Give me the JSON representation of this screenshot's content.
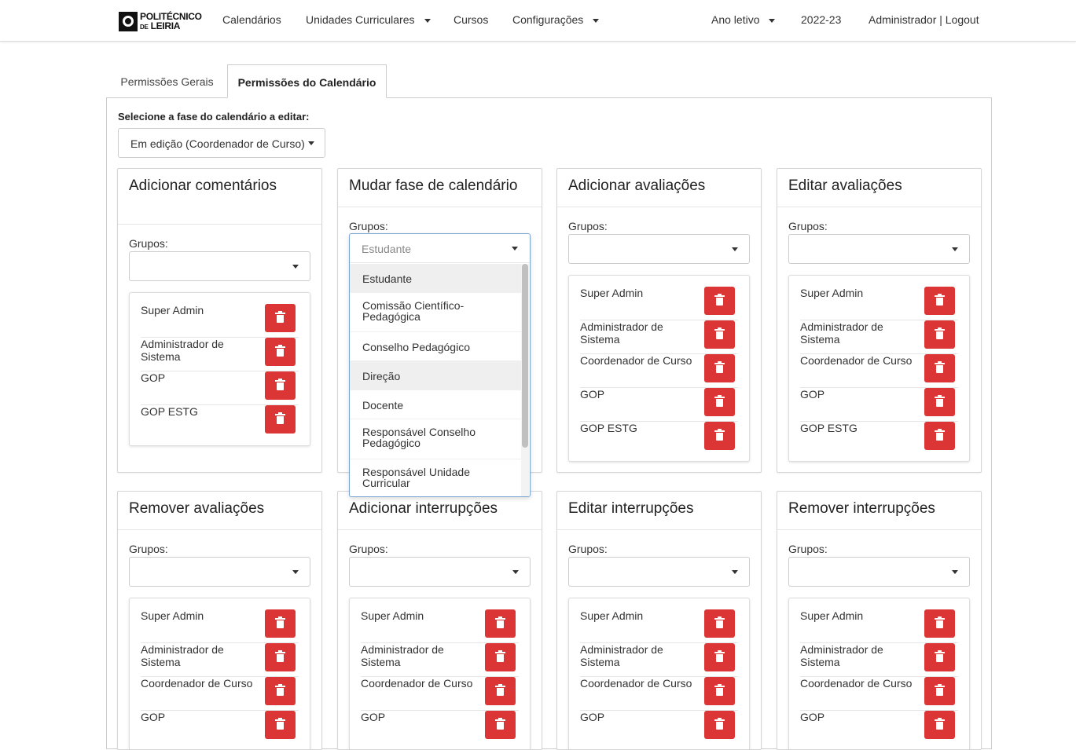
{
  "nav": {
    "logo_line1": "POLITÉCNICO",
    "logo_de": "DE",
    "logo_line2": "LEIRIA",
    "items": [
      "Calendários",
      "Unidades Curriculares",
      "Cursos",
      "Configurações"
    ],
    "ano_letivo": "Ano letivo",
    "year": "2022-23",
    "user": "Administrador | Logout"
  },
  "tabs": [
    "Permissões Gerais",
    "Permissões do Calendário"
  ],
  "phase": {
    "label": "Selecione a fase do calendário a editar:",
    "value": "Em edição (Coordenador de Curso)"
  },
  "groups_label": "Grupos:",
  "cards": [
    {
      "title": "Adicionar comentários",
      "rows": [
        "Super Admin",
        "Administrador de Sistema",
        "GOP",
        "GOP ESTG"
      ]
    },
    {
      "title": "Mudar fase de calendário",
      "rows": []
    },
    {
      "title": "Adicionar avaliações",
      "rows": [
        "Super Admin",
        "Administrador de Sistema",
        "Coordenador de Curso",
        "GOP",
        "GOP ESTG"
      ]
    },
    {
      "title": "Editar avaliações",
      "rows": [
        "Super Admin",
        "Administrador de Sistema",
        "Coordenador de Curso",
        "GOP",
        "GOP ESTG"
      ]
    },
    {
      "title": "Remover avaliações",
      "rows": [
        "Super Admin",
        "Administrador de Sistema",
        "Coordenador de Curso",
        "GOP"
      ]
    },
    {
      "title": "Adicionar interrupções",
      "rows": [
        "Super Admin",
        "Administrador de Sistema",
        "Coordenador de Curso",
        "GOP"
      ]
    },
    {
      "title": "Editar interrupções",
      "rows": [
        "Super Admin",
        "Administrador de Sistema",
        "Coordenador de Curso",
        "GOP"
      ]
    },
    {
      "title": "Remover interrupções",
      "rows": [
        "Super Admin",
        "Administrador de Sistema",
        "Coordenador de Curso",
        "GOP"
      ]
    }
  ],
  "dropdown": {
    "selected": "Estudante",
    "options": [
      "Estudante",
      "Comissão Científico-Pedagógica",
      "Conselho Pedagógico",
      "Direção",
      "Docente",
      "Responsável Conselho Pedagógico",
      "Responsável Unidade Curricular"
    ]
  },
  "colors": {
    "delete": "#dc3535",
    "focus_border": "#7aa6d6"
  }
}
